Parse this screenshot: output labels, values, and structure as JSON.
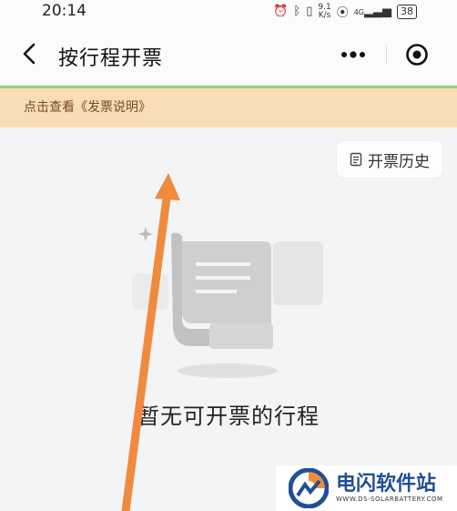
{
  "status_bar": {
    "time": "20:14",
    "speed_value": "9.1",
    "speed_unit": "K/s",
    "network": "4G",
    "battery": "38"
  },
  "nav": {
    "title": "按行程开票"
  },
  "notice": {
    "text": "点击查看《发票说明》"
  },
  "history_button": {
    "label": "开票历史"
  },
  "empty_state": {
    "text": "暂无可开票的行程"
  },
  "watermark": {
    "title": "电闪软件站",
    "subtitle": "WWW.DS-SOLARBATTERY.COM"
  },
  "colors": {
    "notice_bg": "#f8ddb7",
    "accent_line": "#8fcf7e",
    "arrow": "#f08a3c",
    "watermark_blue": "#1f4f96"
  }
}
